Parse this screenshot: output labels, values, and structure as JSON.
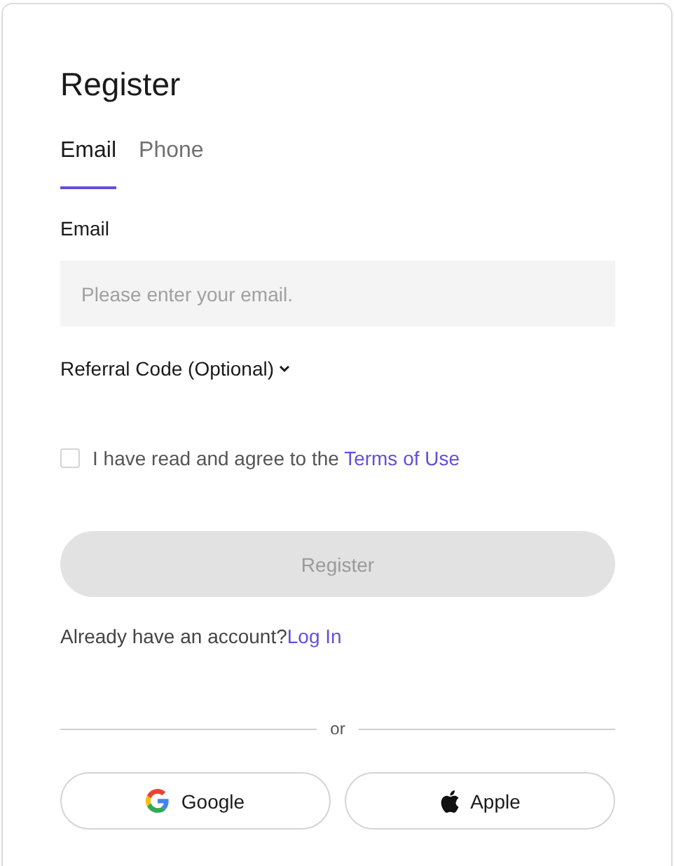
{
  "title": "Register",
  "tabs": [
    {
      "label": "Email",
      "selected": true
    },
    {
      "label": "Phone",
      "selected": false
    }
  ],
  "email_field": {
    "label": "Email",
    "placeholder": "Please enter your email."
  },
  "referral": {
    "label": "Referral Code (Optional)"
  },
  "agreement": {
    "text": "I have read and agree to the",
    "link": "Terms of Use",
    "checked": false
  },
  "register_button": {
    "label": "Register",
    "disabled": true
  },
  "login_prompt": {
    "text": "Already have an account?",
    "link": "Log In"
  },
  "divider": "or",
  "social_buttons": [
    {
      "kind": "google",
      "label": "Google"
    },
    {
      "kind": "apple",
      "label": "Apple"
    }
  ]
}
